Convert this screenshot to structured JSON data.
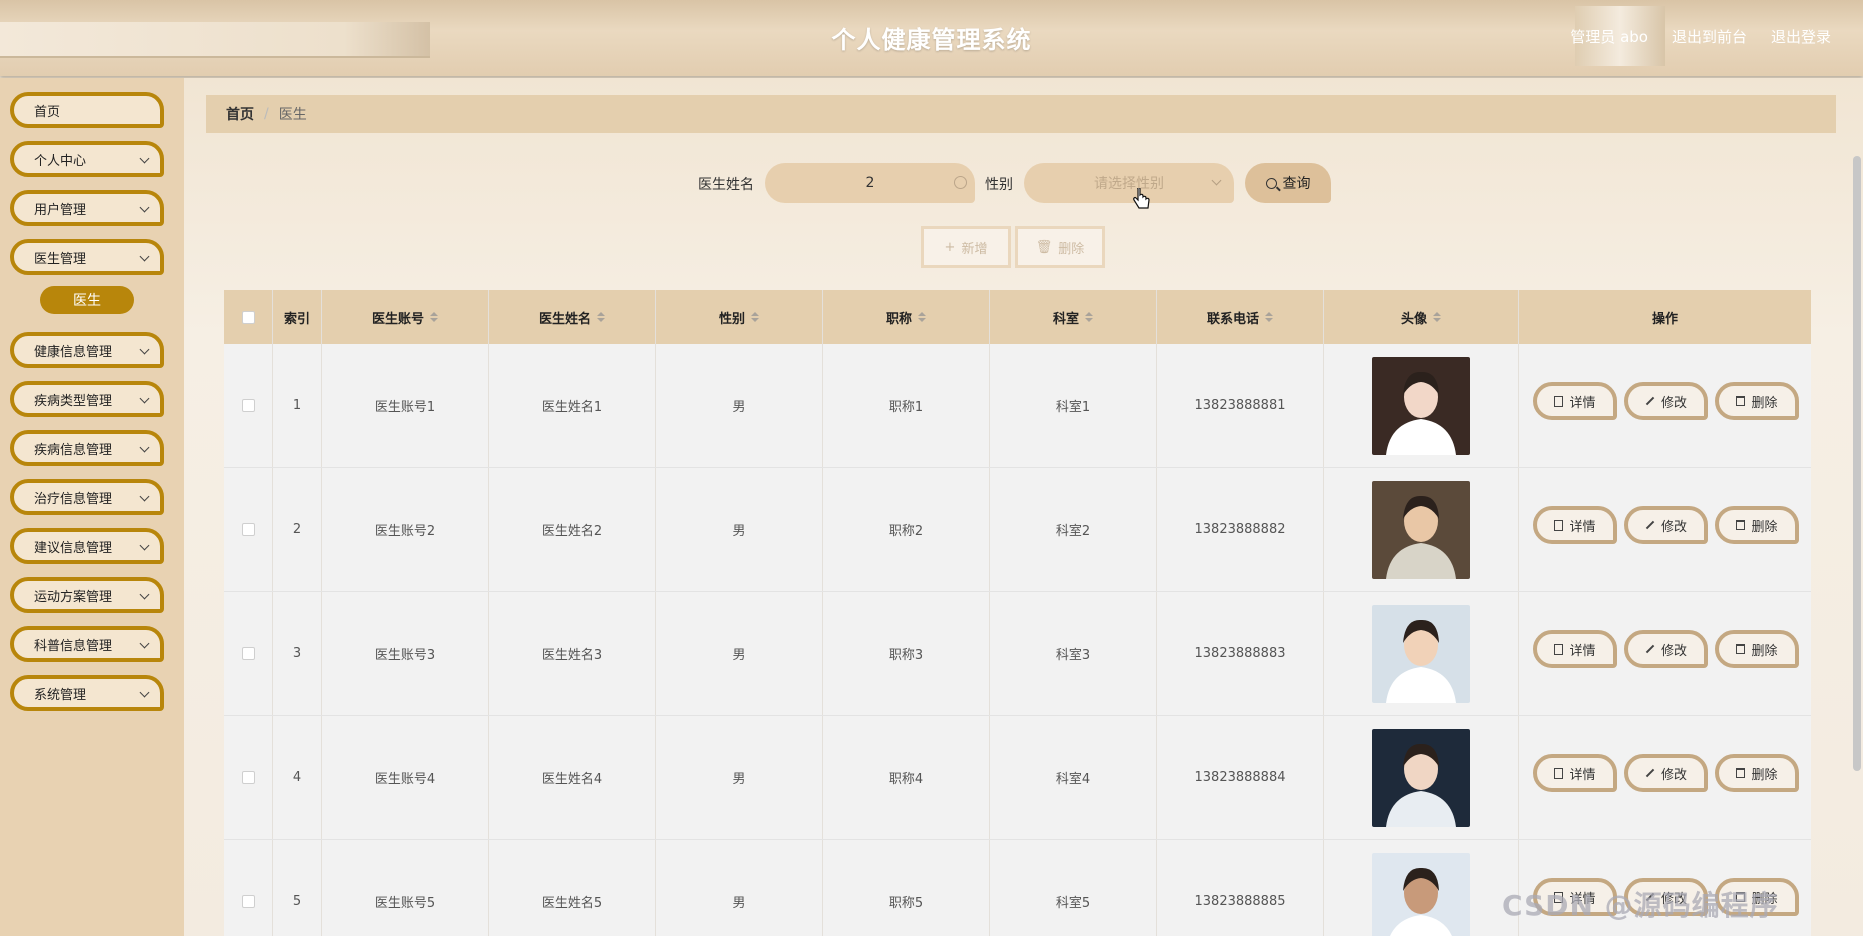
{
  "header": {
    "title": "个人健康管理系统",
    "admin_label": "管理员 abo",
    "front_link": "退出到前台",
    "logout_link": "退出登录"
  },
  "sidebar": {
    "items": [
      {
        "label": "首页",
        "chevron": false
      },
      {
        "label": "个人中心",
        "chevron": true
      },
      {
        "label": "用户管理",
        "chevron": true
      },
      {
        "label": "医生管理",
        "chevron": true
      },
      {
        "label": "健康信息管理",
        "chevron": true
      },
      {
        "label": "疾病类型管理",
        "chevron": true
      },
      {
        "label": "疾病信息管理",
        "chevron": true
      },
      {
        "label": "治疗信息管理",
        "chevron": true
      },
      {
        "label": "建议信息管理",
        "chevron": true
      },
      {
        "label": "运动方案管理",
        "chevron": true
      },
      {
        "label": "科普信息管理",
        "chevron": true
      },
      {
        "label": "系统管理",
        "chevron": true
      }
    ],
    "active_sub": "医生"
  },
  "breadcrumb": {
    "home": "首页",
    "separator": "/",
    "current": "医生"
  },
  "search": {
    "name_label": "医生姓名",
    "name_value": "2",
    "gender_label": "性别",
    "gender_placeholder": "请选择性别",
    "search_button": "查询"
  },
  "actions": {
    "add": "新增",
    "delete": "删除"
  },
  "table": {
    "headers": [
      "索引",
      "医生账号",
      "医生姓名",
      "性别",
      "职称",
      "科室",
      "联系电话",
      "头像",
      "操作"
    ],
    "rows": [
      {
        "index": "1",
        "account": "医生账号1",
        "name": "医生姓名1",
        "gender": "男",
        "title": "职称1",
        "dept": "科室1",
        "phone": "13823888881"
      },
      {
        "index": "2",
        "account": "医生账号2",
        "name": "医生姓名2",
        "gender": "男",
        "title": "职称2",
        "dept": "科室2",
        "phone": "13823888882"
      },
      {
        "index": "3",
        "account": "医生账号3",
        "name": "医生姓名3",
        "gender": "男",
        "title": "职称3",
        "dept": "科室3",
        "phone": "13823888883"
      },
      {
        "index": "4",
        "account": "医生账号4",
        "name": "医生姓名4",
        "gender": "男",
        "title": "职称4",
        "dept": "科室4",
        "phone": "13823888884"
      },
      {
        "index": "5",
        "account": "医生账号5",
        "name": "医生姓名5",
        "gender": "男",
        "title": "职称5",
        "dept": "科室5",
        "phone": "13823888885"
      }
    ],
    "row_buttons": {
      "detail": "详情",
      "edit": "修改",
      "delete": "删除"
    }
  },
  "watermark": "CSDN @源码编程序"
}
